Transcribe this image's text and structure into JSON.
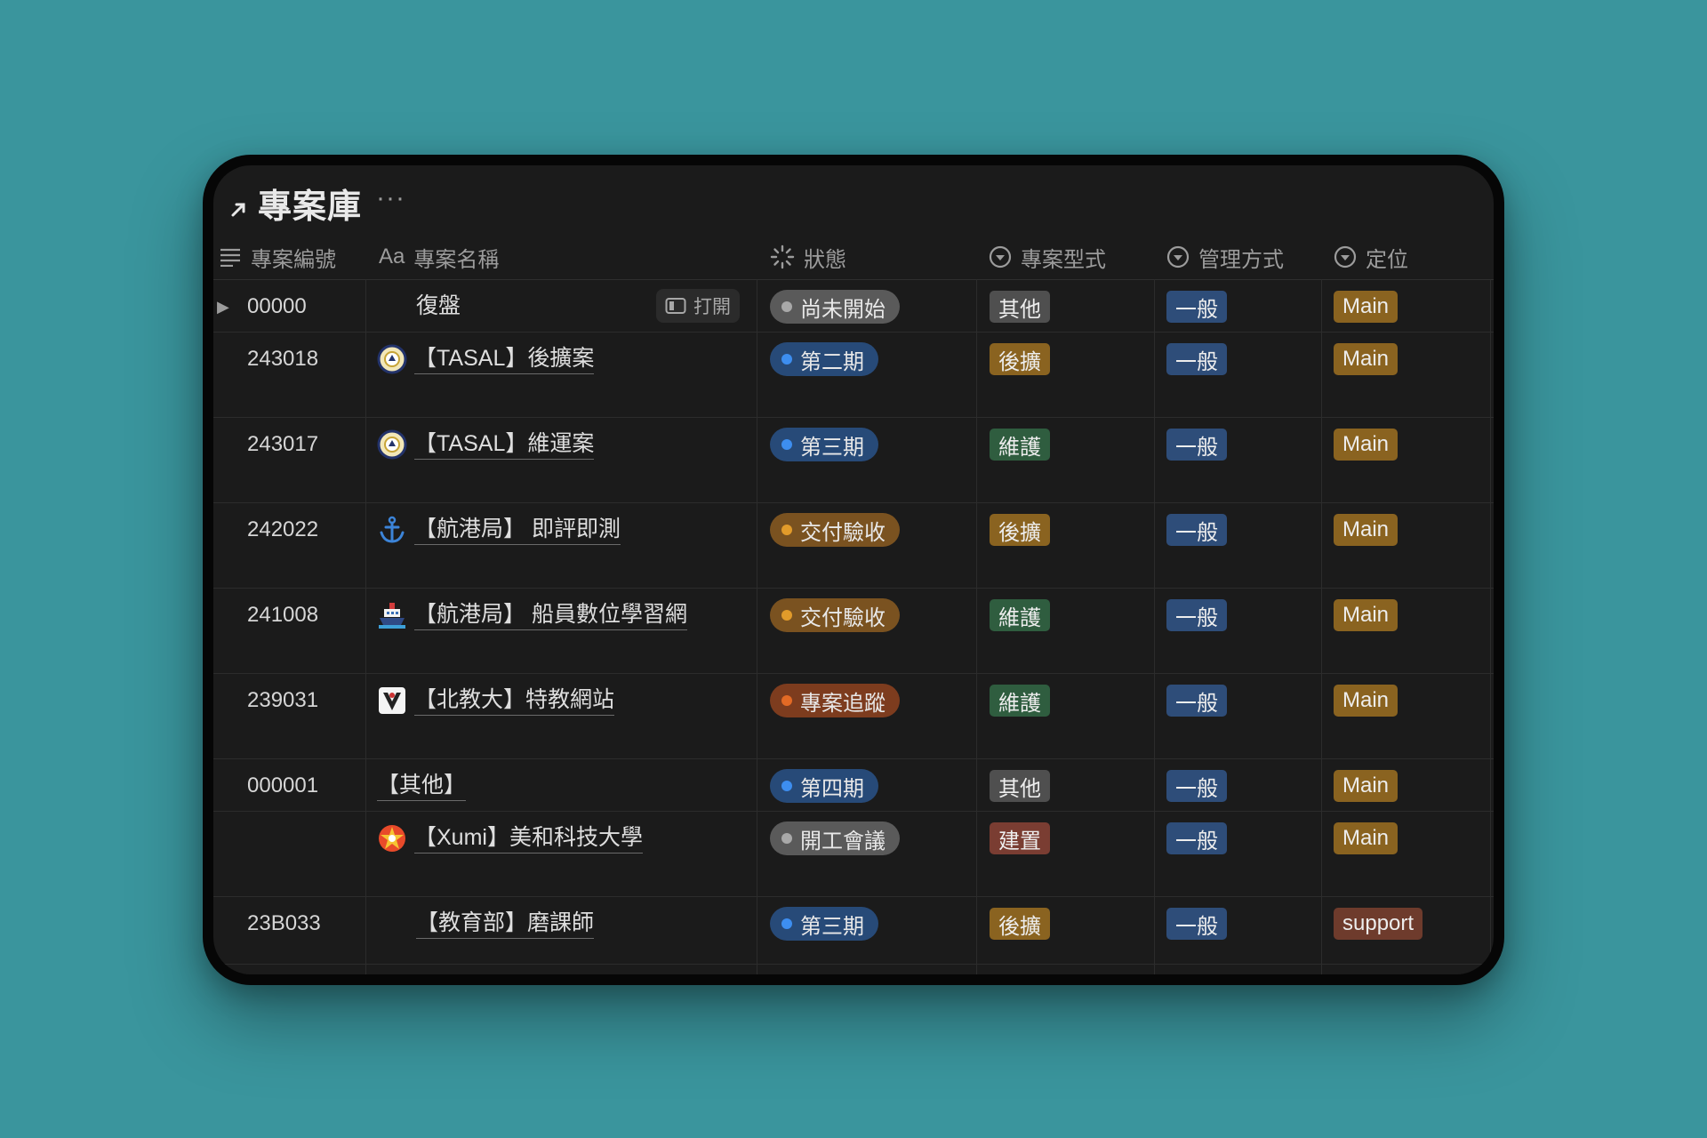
{
  "database": {
    "title": "專案庫",
    "more_label": "···"
  },
  "columns": {
    "number": "專案編號",
    "name_prefix": "Aa",
    "name": "專案名稱",
    "status": "狀態",
    "type": "專案型式",
    "management": "管理方式",
    "position": "定位"
  },
  "open_label": "打開",
  "colors": {
    "status_gray": "#5a5a5a",
    "status_blue": "#274a78",
    "status_orange": "#7a5220",
    "status_red_orange": "#7d3c1e",
    "type_gray": "#4f4f4f",
    "type_brown": "#8a6320",
    "type_green": "#2f5d3f",
    "type_red": "#7a3d32",
    "mgmt_blue": "#2e4d79",
    "pos_gold": "#8a6320",
    "pos_support": "#6e3b2c"
  },
  "rows": [
    {
      "number": "00000",
      "icon": "none",
      "name": "復盤",
      "status": "尚未開始",
      "status_color": "gray",
      "type": "其他",
      "type_color": "gray",
      "management": "一般",
      "position": "Main"
    },
    {
      "number": "243018",
      "icon": "tasal-logo-icon",
      "name": "【TASAL】後擴案",
      "status": "第二期",
      "status_color": "blue",
      "type": "後擴",
      "type_color": "brown",
      "management": "一般",
      "position": "Main"
    },
    {
      "number": "243017",
      "icon": "tasal-logo-icon",
      "name": "【TASAL】維運案",
      "status": "第三期",
      "status_color": "blue",
      "type": "維護",
      "type_color": "green",
      "management": "一般",
      "position": "Main"
    },
    {
      "number": "242022",
      "icon": "anchor-icon",
      "name": "【航港局】 即評即測",
      "status": "交付驗收",
      "status_color": "orange",
      "type": "後擴",
      "type_color": "brown",
      "management": "一般",
      "position": "Main"
    },
    {
      "number": "241008",
      "icon": "ship-icon",
      "name": "【航港局】 船員數位學習網",
      "status": "交付驗收",
      "status_color": "orange",
      "type": "維護",
      "type_color": "green",
      "management": "一般",
      "position": "Main"
    },
    {
      "number": "239031",
      "icon": "ntue-logo-icon",
      "name": "【北教大】特教網站",
      "status": "專案追蹤",
      "status_color": "red_orange",
      "type": "維護",
      "type_color": "green",
      "management": "一般",
      "position": "Main"
    },
    {
      "number": "000001",
      "icon": "none",
      "name": "【其他】",
      "status": "第四期",
      "status_color": "blue",
      "type": "其他",
      "type_color": "gray",
      "management": "一般",
      "position": "Main"
    },
    {
      "number": "",
      "icon": "meiho-logo-icon",
      "name": "【Xumi】美和科技大學",
      "status": "開工會議",
      "status_color": "gray",
      "type": "建置",
      "type_color": "red",
      "management": "一般",
      "position": "Main"
    },
    {
      "number": "23B033",
      "icon": "none",
      "name": "【教育部】磨課師",
      "status": "第三期",
      "status_color": "blue",
      "type": "後擴",
      "type_color": "brown",
      "management": "一般",
      "position": "support"
    }
  ]
}
